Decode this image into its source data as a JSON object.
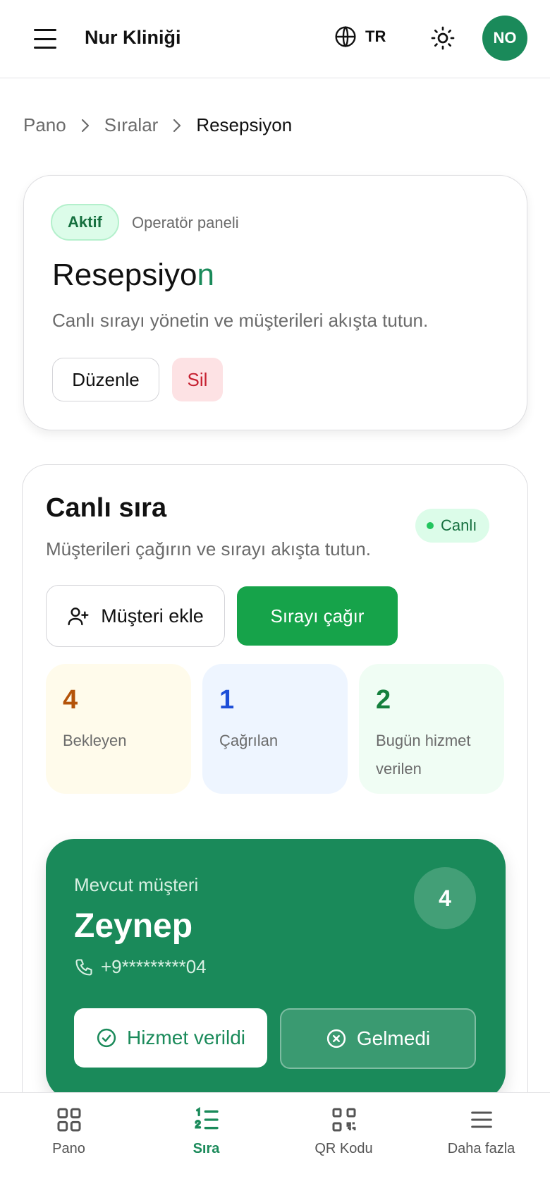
{
  "header": {
    "title": "Nur Kliniği",
    "language": "TR",
    "avatar_initials": "NO",
    "menu_icon": "menu-icon",
    "language_icon": "globe-icon",
    "theme_icon": "sun-icon"
  },
  "breadcrumb": {
    "items": [
      "Pano",
      "Sıralar",
      "Resepsiyon"
    ]
  },
  "queue": {
    "status_badge": "Aktif",
    "panel_label": "Operatör paneli",
    "title_main": "Resepsiyo",
    "title_accent": "n",
    "description": "Canlı sırayı yönetin ve müşterileri akışta tutun.",
    "edit_label": "Düzenle",
    "delete_label": "Sil"
  },
  "live": {
    "title": "Canlı sıra",
    "description": "Müşterileri çağırın ve sırayı akışta tutun.",
    "live_badge": "Canlı",
    "add_customer_label": "Müşteri ekle",
    "call_queue_label": "Sırayı çağır",
    "stats": {
      "waiting": {
        "value": "4",
        "label": "Bekleyen"
      },
      "called": {
        "value": "1",
        "label": "Çağrılan"
      },
      "served": {
        "value": "2",
        "label_line1": "Bugün hizmet",
        "label_line2": "verilen"
      }
    },
    "current": {
      "label": "Mevcut müşteri",
      "name": "Zeynep",
      "phone": "+9*********04",
      "number": "4",
      "served_label": "Hizmet verildi",
      "noshow_label": "Gelmedi"
    }
  },
  "bottom_nav": {
    "items": [
      {
        "label": "Pano",
        "icon": "dashboard-icon"
      },
      {
        "label": "Sıra",
        "icon": "ordered-list-icon"
      },
      {
        "label": "QR Kodu",
        "icon": "qr-code-icon"
      },
      {
        "label": "Daha fazla",
        "icon": "menu-icon"
      }
    ]
  },
  "colors": {
    "brand": "#1a8a5a",
    "primary_button": "#16a34a",
    "danger": "#c62030",
    "waiting": "#b45309",
    "called": "#1d4ed8",
    "served": "#15803d"
  }
}
